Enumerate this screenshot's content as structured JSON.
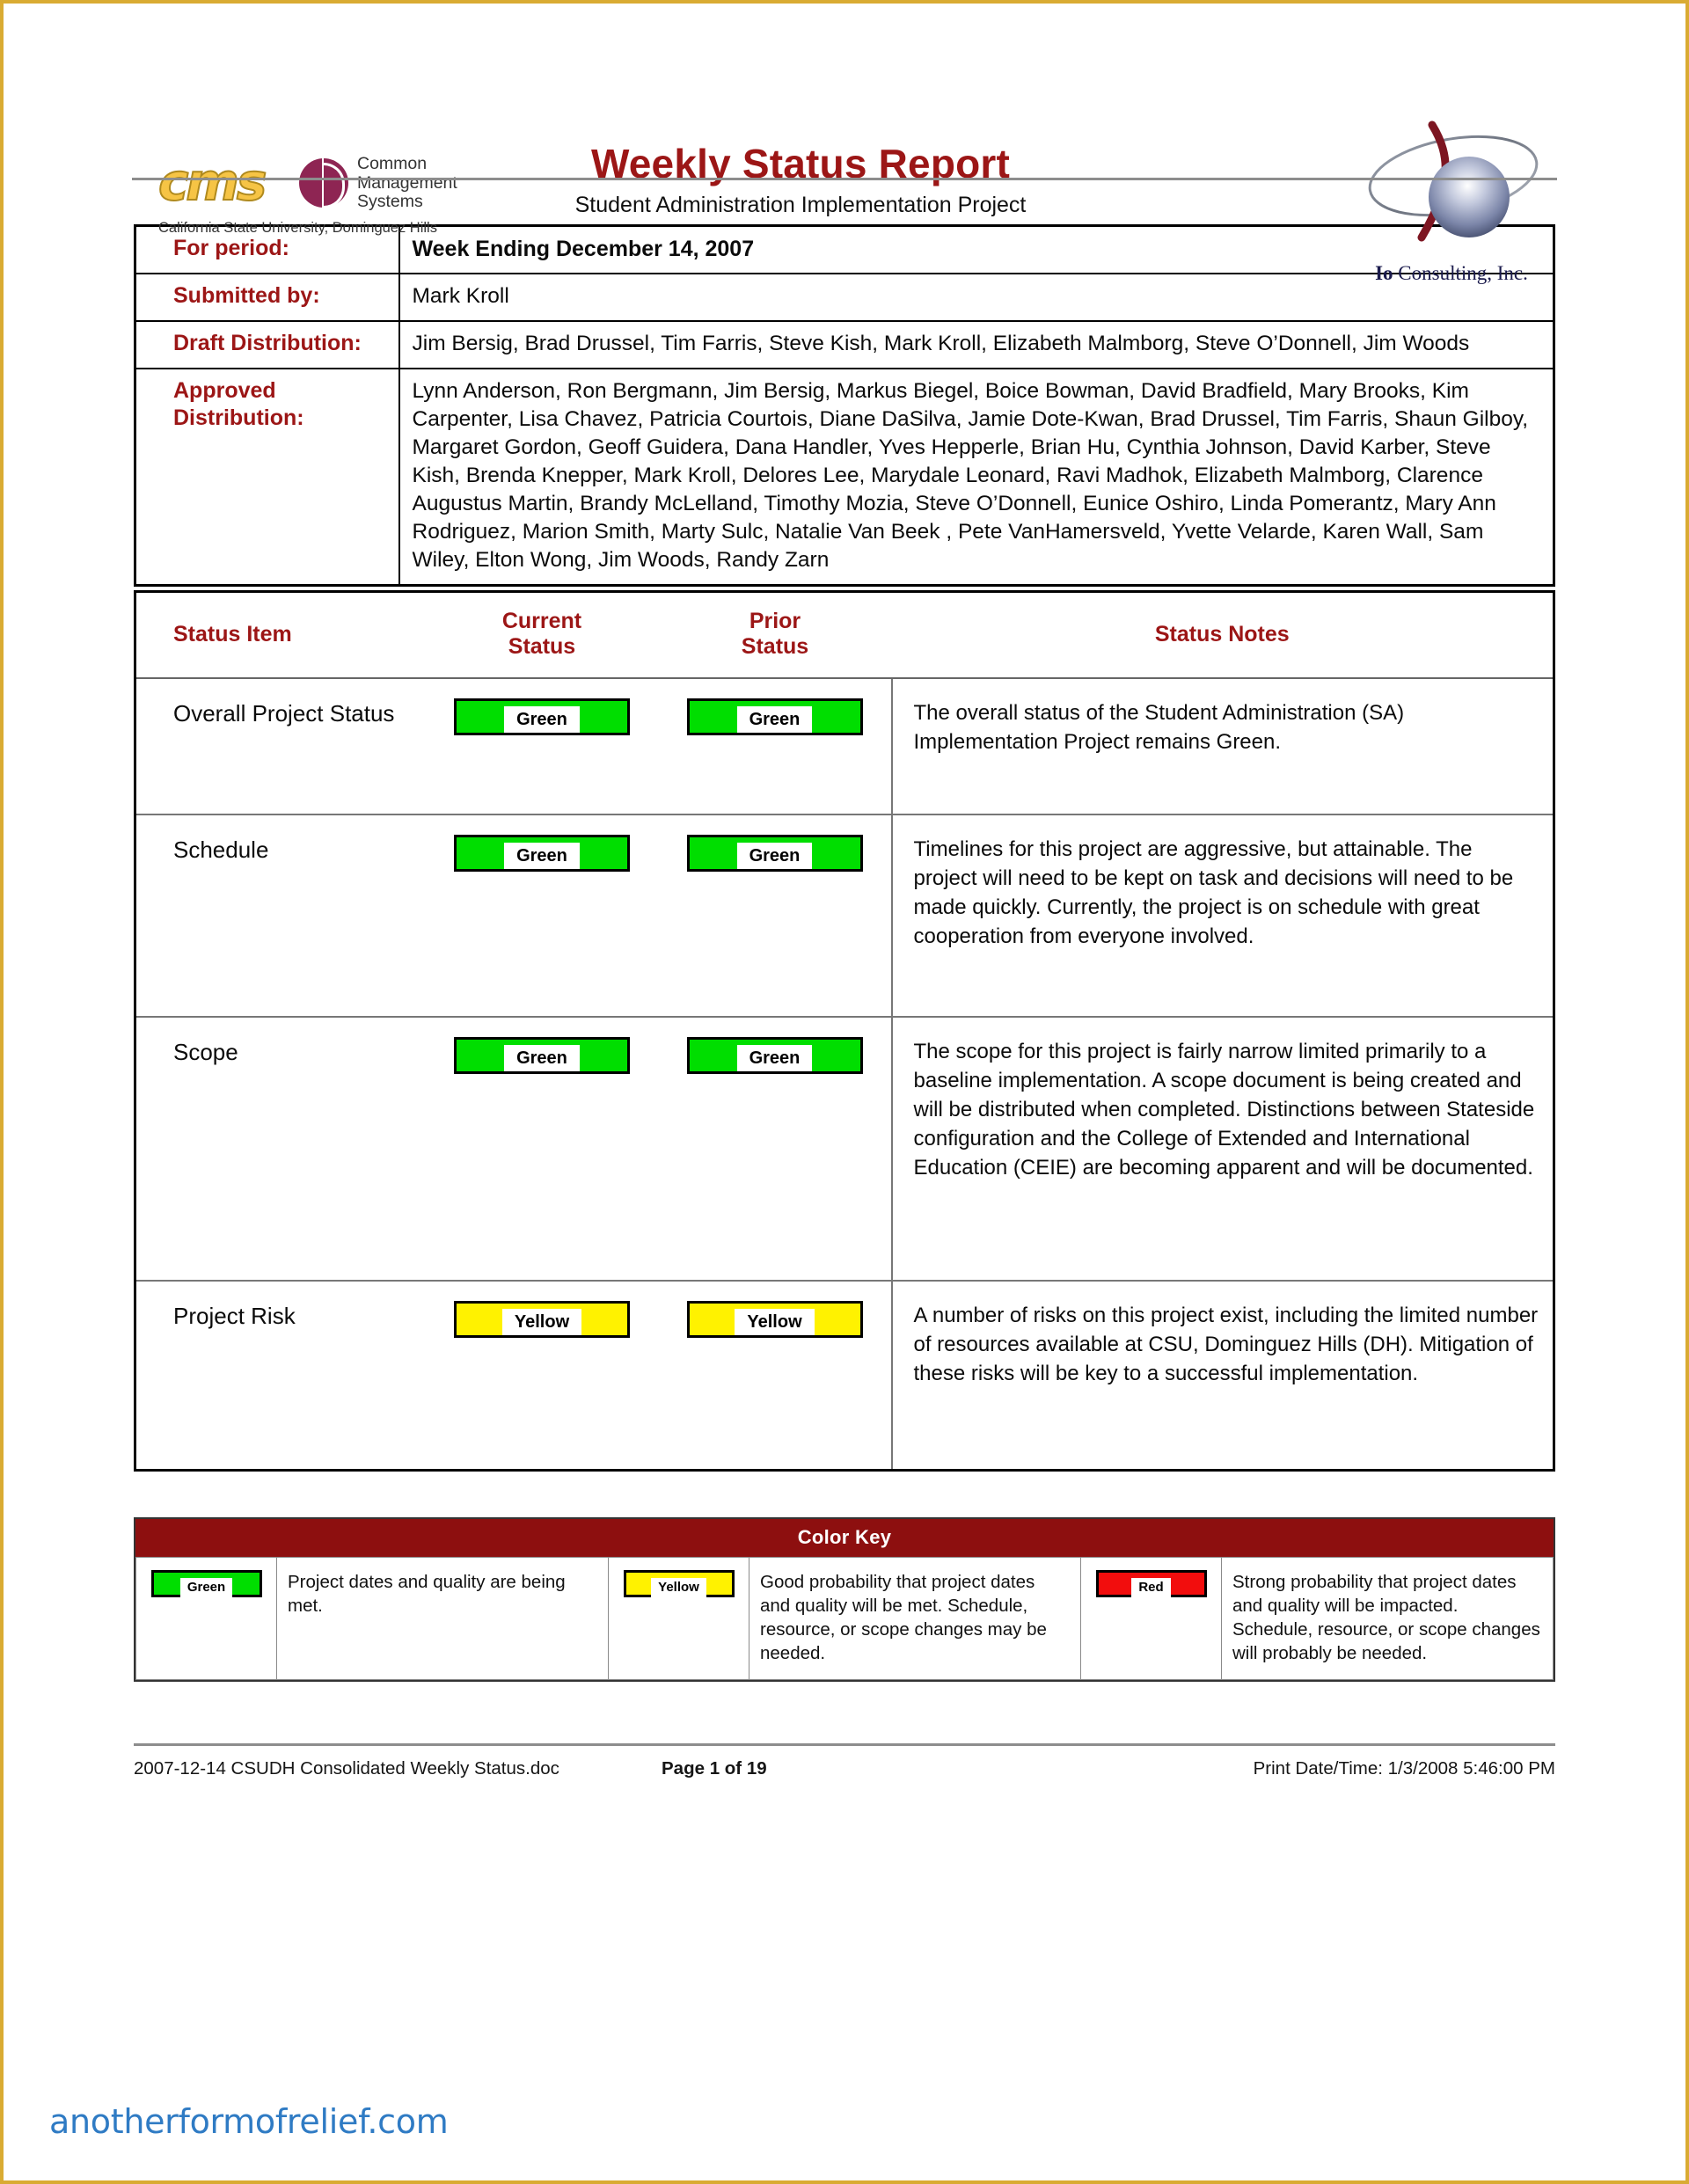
{
  "page": {
    "frame_color": "#d9ab33"
  },
  "header": {
    "cms_logo": {
      "wordmark": "cms",
      "line1": "Common",
      "line2": "Management",
      "line3": "Systems",
      "subtitle": "California State University, Dominguez Hills"
    },
    "title": "Weekly Status Report",
    "subtitle": "Student Administration Implementation Project",
    "consulting_logo": {
      "name_bold": "Io",
      "name_rest": " Consulting, Inc."
    }
  },
  "info": {
    "rows": [
      {
        "label": "For period:",
        "value": "Week Ending December 14, 2007",
        "bold": true
      },
      {
        "label": "Submitted by:",
        "value": "Mark Kroll",
        "bold": false
      },
      {
        "label": "Draft Distribution:",
        "value": "Jim Bersig, Brad Drussel, Tim Farris, Steve Kish, Mark Kroll, Elizabeth Malmborg, Steve O’Donnell, Jim Woods",
        "bold": false
      },
      {
        "label": "Approved Distribution:",
        "value": "Lynn Anderson, Ron Bergmann, Jim Bersig, Markus Biegel, Boice Bowman, David Bradfield, Mary Brooks, Kim Carpenter, Lisa Chavez, Patricia Courtois, Diane DaSilva, Jamie Dote-Kwan, Brad Drussel, Tim Farris, Shaun Gilboy, Margaret Gordon, Geoff Guidera, Dana Handler, Yves Hepperle, Brian Hu, Cynthia Johnson, David Karber, Steve Kish, Brenda Knepper, Mark Kroll, Delores Lee, Marydale Leonard, Ravi Madhok, Elizabeth Malmborg, Clarence Augustus Martin, Brandy McLelland, Timothy Mozia, Steve O’Donnell, Eunice Oshiro, Linda Pomerantz, Mary Ann Rodriguez, Marion Smith, Marty Sulc, Natalie Van Beek , Pete VanHamersveld, Yvette Velarde, Karen Wall, Sam Wiley, Elton Wong, Jim Woods, Randy Zarn",
        "bold": false
      }
    ]
  },
  "status_table": {
    "headers": {
      "item": "Status Item",
      "current_l1": "Current",
      "current_l2": "Status",
      "prior_l1": "Prior",
      "prior_l2": "Status",
      "notes": "Status Notes"
    },
    "rows": [
      {
        "item": "Overall Project Status",
        "current": "Green",
        "prior": "Green",
        "notes": "The overall status of the Student Administration (SA) Implementation Project remains Green."
      },
      {
        "item": "Schedule",
        "current": "Green",
        "prior": "Green",
        "notes": "Timelines for this project are aggressive, but attainable.  The project will need to be kept on task and decisions will need to be made quickly.  Currently, the project is on schedule with great cooperation from everyone involved."
      },
      {
        "item": "Scope",
        "current": "Green",
        "prior": "Green",
        "notes": "The scope for this project is fairly narrow limited primarily to a baseline implementation.  A scope document is being created and will be distributed when completed.  Distinctions between Stateside configuration and the College of Extended and International Education (CEIE) are becoming apparent and will be documented."
      },
      {
        "item": "Project Risk",
        "current": "Yellow",
        "prior": "Yellow",
        "notes": "A number of risks on this project exist, including the limited number of resources available at CSU, Dominguez Hills (DH).  Mitigation of these risks will be key to a successful implementation."
      }
    ]
  },
  "color_key": {
    "title": "Color Key",
    "header_bg": "#8d0f0f",
    "entries": [
      {
        "label": "Green",
        "color": "#00de00",
        "description": "Project dates and quality are being met."
      },
      {
        "label": "Yellow",
        "color": "#fff200",
        "description": "Good probability that project dates and quality will be met. Schedule, resource, or scope changes may be needed."
      },
      {
        "label": "Red",
        "color": "#f20d0d",
        "description": "Strong probability that project dates and quality will be impacted.  Schedule, resource, or scope changes will probably be needed."
      }
    ]
  },
  "footer": {
    "filename": "2007-12-14 CSUDH Consolidated Weekly Status.doc",
    "page": "Page 1 of 19",
    "print_label": "Print Date/Time:",
    "print_value": "1/3/2008 5:46:00 PM"
  },
  "watermark": "anotherformofrelief.com"
}
